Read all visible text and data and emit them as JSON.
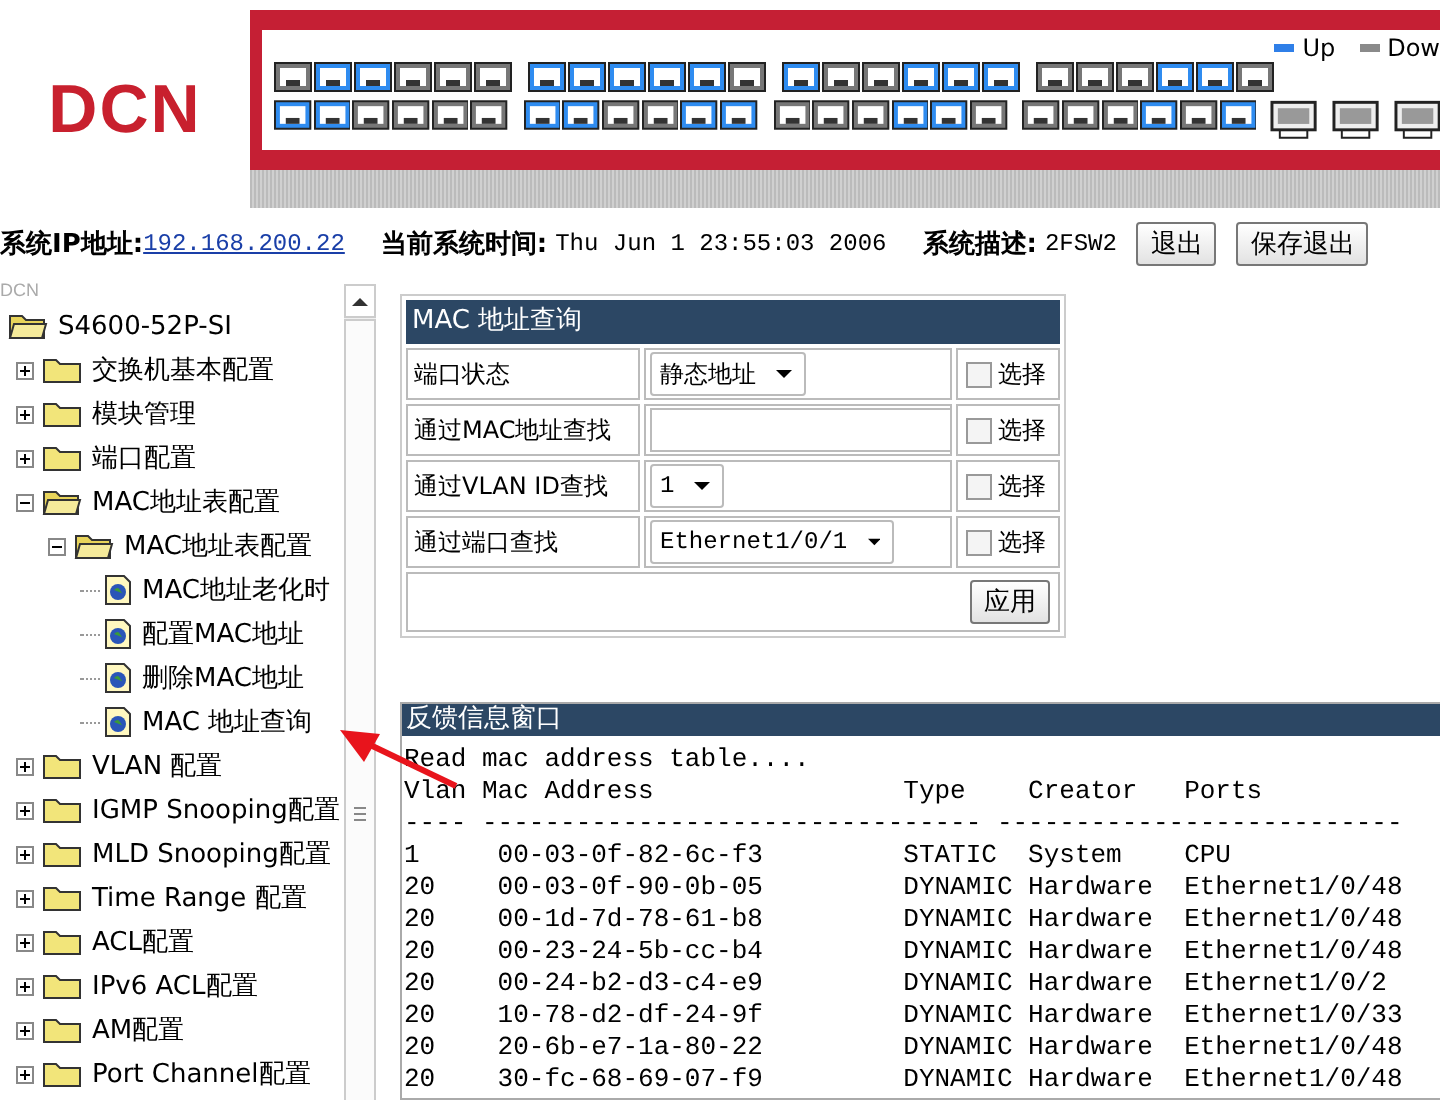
{
  "header": {
    "logo": "DCN",
    "legend": [
      {
        "label": "Up",
        "color": "#2f7fe8"
      },
      {
        "label": "Dow",
        "color": "#8a8a8a"
      }
    ],
    "ports": [
      [
        false,
        true,
        true,
        false,
        false,
        false,
        true,
        true,
        true,
        true,
        true,
        false,
        true,
        false,
        false,
        true,
        true,
        true,
        false,
        false,
        false,
        true,
        true,
        false
      ],
      [
        true,
        true,
        false,
        false,
        false,
        false,
        true,
        true,
        false,
        false,
        true,
        true,
        false,
        false,
        false,
        true,
        true,
        false,
        false,
        false,
        false,
        true,
        false,
        true
      ]
    ]
  },
  "info": {
    "ip_label": "系统IP地址:",
    "ip": "192.168.200.22",
    "time_label": "当前系统时间:",
    "time": "Thu Jun 1 23:55:03 2006",
    "desc_label": "系统描述:",
    "desc": "2FSW2",
    "buttons": [
      "退出",
      "保存退出"
    ]
  },
  "sidebar": {
    "caption": "DCN",
    "root": "S4600-52P-SI",
    "items": [
      {
        "label": "交换机基本配置",
        "kind": "folder",
        "expanded": false
      },
      {
        "label": "模块管理",
        "kind": "folder",
        "expanded": false
      },
      {
        "label": "端口配置",
        "kind": "folder",
        "expanded": false
      },
      {
        "label": "MAC地址表配置",
        "kind": "folder",
        "expanded": true,
        "children": [
          {
            "label": "MAC地址表配置",
            "kind": "folder",
            "expanded": true,
            "children": [
              {
                "label": "MAC地址老化时",
                "kind": "page"
              },
              {
                "label": "配置MAC地址",
                "kind": "page"
              },
              {
                "label": "删除MAC地址",
                "kind": "page"
              },
              {
                "label": "MAC 地址查询",
                "kind": "page"
              }
            ]
          }
        ]
      },
      {
        "label": "VLAN 配置",
        "kind": "folder",
        "expanded": false
      },
      {
        "label": "IGMP Snooping配置",
        "kind": "folder",
        "expanded": false
      },
      {
        "label": "MLD Snooping配置",
        "kind": "folder",
        "expanded": false
      },
      {
        "label": "Time Range 配置",
        "kind": "folder",
        "expanded": false
      },
      {
        "label": "ACL配置",
        "kind": "folder",
        "expanded": false
      },
      {
        "label": "IPv6 ACL配置",
        "kind": "folder",
        "expanded": false
      },
      {
        "label": "AM配置",
        "kind": "folder",
        "expanded": false
      },
      {
        "label": "Port Channel配置",
        "kind": "folder",
        "expanded": false
      }
    ]
  },
  "form": {
    "title": "MAC 地址查询",
    "rows": [
      {
        "label": "端口状态",
        "kind": "select",
        "value": "静态地址",
        "check_label": "选择",
        "checked": false
      },
      {
        "label": "通过MAC地址查找",
        "kind": "text",
        "value": "",
        "check_label": "选择",
        "checked": false
      },
      {
        "label": "通过VLAN ID查找",
        "kind": "select",
        "value": "1",
        "check_label": "选择",
        "checked": false
      },
      {
        "label": "通过端口查找",
        "kind": "select",
        "value": "Ethernet1/0/1",
        "check_label": "选择",
        "checked": false
      }
    ],
    "apply": "应用"
  },
  "feedback": {
    "title": "反馈信息窗口",
    "lines": [
      "Read mac address table....",
      "Vlan Mac Address                Type    Creator   Ports",
      "---- -------------------------------- --------------------------",
      "1     00-03-0f-82-6c-f3         STATIC  System    CPU",
      "20    00-03-0f-90-0b-05         DYNAMIC Hardware  Ethernet1/0/48",
      "20    00-1d-7d-78-61-b8         DYNAMIC Hardware  Ethernet1/0/48",
      "20    00-23-24-5b-cc-b4         DYNAMIC Hardware  Ethernet1/0/48",
      "20    00-24-b2-d3-c4-e9         DYNAMIC Hardware  Ethernet1/0/2",
      "20    10-78-d2-df-24-9f         DYNAMIC Hardware  Ethernet1/0/33",
      "20    20-6b-e7-1a-80-22         DYNAMIC Hardware  Ethernet1/0/48",
      "20    30-fc-68-69-07-f9         DYNAMIC Hardware  Ethernet1/0/48"
    ]
  }
}
